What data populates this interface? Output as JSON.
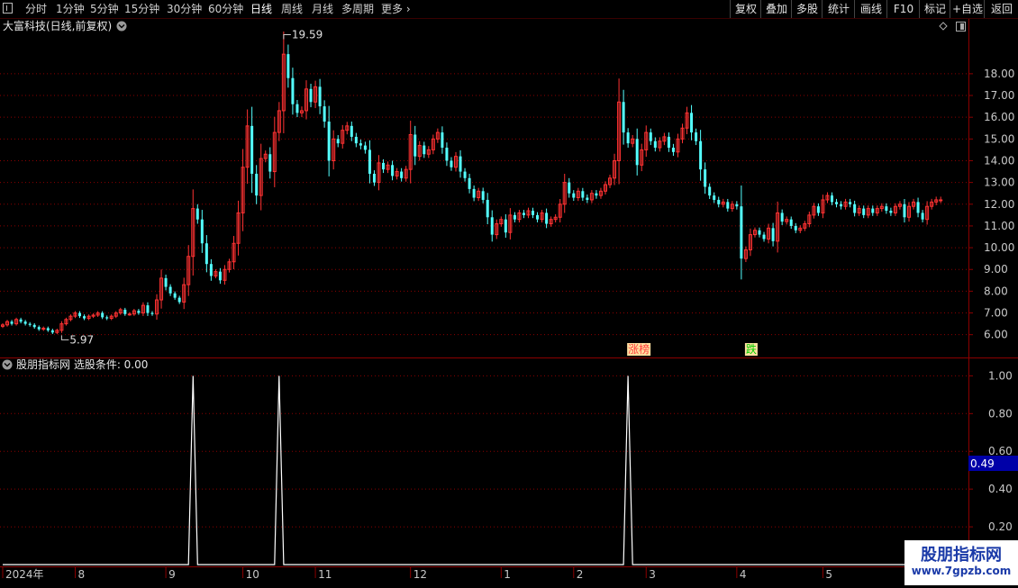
{
  "toolbar": {
    "periods": [
      {
        "label": "分时",
        "active": false
      },
      {
        "label": "1分钟",
        "active": false
      },
      {
        "label": "5分钟",
        "active": false
      },
      {
        "label": "15分钟",
        "active": false
      },
      {
        "label": "30分钟",
        "active": false
      },
      {
        "label": "60分钟",
        "active": false
      },
      {
        "label": "日线",
        "active": true
      },
      {
        "label": "周线",
        "active": false
      },
      {
        "label": "月线",
        "active": false
      },
      {
        "label": "多周期",
        "active": false
      },
      {
        "label": "更多",
        "active": false
      }
    ],
    "right_buttons": [
      "复权",
      "叠加",
      "多股",
      "统计",
      "画线",
      "F10",
      "标记",
      "+自选",
      "返回"
    ]
  },
  "main_panel": {
    "title": "大富科技(日线,前复权)",
    "high_marker": "19.59",
    "low_marker": "5.97",
    "badges": [
      {
        "text": "涨榜",
        "color": "#ff4040"
      },
      {
        "text": "跌",
        "color": "#00d000"
      }
    ]
  },
  "indicator_panel": {
    "title": "股朋指标网 选股条件: 0.00",
    "cursor_value": "0.49"
  },
  "watermark": {
    "title": "股朋指标网",
    "url": "www.7gpzb.com"
  },
  "colors": {
    "up": "#ff3232",
    "down": "#54ffff",
    "grid": "#8b0000",
    "axis_text": "#c8c8c8",
    "badge_bg": "#ffe0a0",
    "cursor_bg": "#0000a8"
  },
  "chart_data": [
    {
      "type": "candlestick",
      "title": "大富科技(日线,前复权)",
      "y_ticks": [
        "6.00",
        "7.00",
        "8.00",
        "9.00",
        "10.00",
        "11.00",
        "12.00",
        "13.00",
        "14.00",
        "15.00",
        "16.00",
        "17.00",
        "18.00"
      ],
      "ylim": [
        5.2,
        19.9
      ],
      "x_ticks": [
        {
          "label": "2024年",
          "day": 0
        },
        {
          "label": "8",
          "day": 16
        },
        {
          "label": "9",
          "day": 36
        },
        {
          "label": "10",
          "day": 53
        },
        {
          "label": "11",
          "day": 69
        },
        {
          "label": "12",
          "day": 90
        },
        {
          "label": "1",
          "day": 110
        },
        {
          "label": "2",
          "day": 126
        },
        {
          "label": "3",
          "day": 142
        },
        {
          "label": "4",
          "day": 162
        },
        {
          "label": "5",
          "day": 181
        }
      ],
      "close": [
        6.45,
        6.6,
        6.5,
        6.7,
        6.6,
        6.5,
        6.45,
        6.35,
        6.25,
        6.3,
        6.2,
        6.1,
        6.2,
        6.5,
        6.7,
        6.85,
        7.0,
        6.85,
        6.75,
        6.85,
        6.9,
        7.0,
        6.8,
        6.75,
        6.85,
        7.0,
        7.15,
        6.95,
        6.95,
        7.1,
        7.0,
        7.35,
        7.0,
        6.95,
        7.6,
        8.6,
        8.2,
        7.9,
        7.7,
        7.5,
        8.3,
        9.6,
        11.8,
        11.3,
        10.2,
        9.25,
        8.7,
        8.9,
        8.5,
        9.0,
        9.35,
        10.2,
        11.6,
        13.7,
        15.6,
        13.4,
        12.4,
        14.1,
        14.3,
        13.5,
        15.3,
        16.3,
        18.9,
        17.8,
        16.6,
        16.2,
        16.3,
        17.3,
        16.7,
        17.4,
        16.5,
        15.8,
        14.0,
        15.0,
        14.8,
        15.4,
        15.6,
        15.1,
        14.8,
        14.7,
        14.5,
        13.4,
        13.0,
        13.9,
        13.6,
        13.8,
        13.3,
        13.5,
        13.2,
        13.6,
        15.2,
        14.2,
        14.7,
        14.3,
        14.5,
        15.0,
        15.3,
        14.6,
        14.0,
        13.7,
        14.2,
        13.5,
        13.2,
        12.7,
        12.3,
        12.6,
        12.2,
        11.4,
        10.6,
        11.1,
        11.3,
        10.7,
        11.5,
        11.3,
        11.6,
        11.5,
        11.7,
        11.5,
        11.3,
        11.6,
        11.1,
        11.3,
        11.4,
        12.0,
        13.0,
        12.5,
        12.3,
        12.6,
        12.3,
        12.2,
        12.5,
        12.4,
        12.6,
        12.9,
        13.2,
        14.0,
        16.7,
        15.3,
        14.8,
        15.0,
        13.8,
        14.5,
        15.3,
        14.9,
        14.6,
        14.9,
        15.1,
        14.6,
        14.4,
        15.0,
        15.5,
        16.2,
        15.3,
        14.9,
        13.6,
        12.8,
        12.4,
        12.2,
        12.0,
        12.1,
        11.8,
        12.0,
        11.9,
        9.5,
        9.9,
        10.6,
        10.8,
        10.6,
        10.4,
        10.9,
        10.3,
        11.6,
        11.2,
        11.3,
        11.0,
        10.8,
        10.9,
        11.1,
        11.5,
        11.9,
        11.6,
        12.2,
        12.4,
        12.1,
        12.0,
        11.9,
        12.1,
        12.0,
        11.6,
        11.8,
        11.5,
        11.8,
        11.6,
        11.8,
        11.9,
        11.7,
        11.6,
        11.9,
        12.0,
        11.4,
        11.9,
        12.1,
        11.6,
        11.3,
        11.9,
        12.1,
        12.2,
        12.2
      ],
      "high_label": {
        "day": 62,
        "value": 19.59
      },
      "low_label": {
        "day": 13,
        "value": 5.97
      },
      "badges": [
        {
          "day": 138,
          "text": "涨榜"
        },
        {
          "day": 164,
          "text": "跌"
        }
      ]
    },
    {
      "type": "line",
      "title": "股朋指标网 选股条件: 0.00",
      "y_ticks": [
        "0.20",
        "0.40",
        "0.60",
        "0.80",
        "1.00"
      ],
      "ylim": [
        0,
        1.04
      ],
      "spike_days": [
        42,
        61,
        138
      ],
      "length": 213
    }
  ]
}
